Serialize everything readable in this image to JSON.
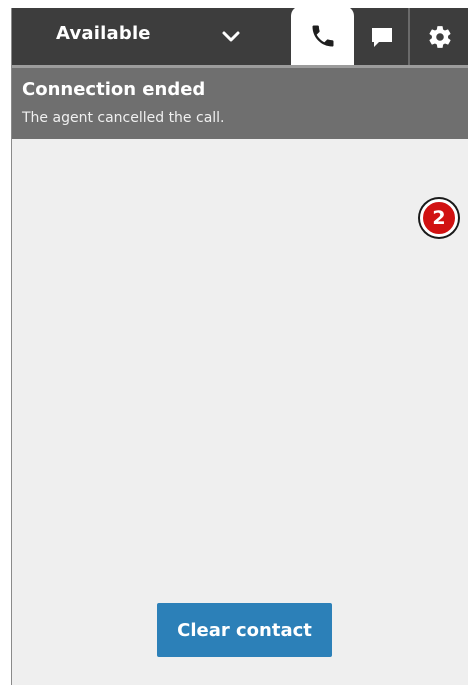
{
  "topbar": {
    "status": {
      "label": "Available",
      "icon": "chevron-down-icon"
    },
    "tabs": [
      {
        "icon": "phone-icon",
        "selected": true
      },
      {
        "icon": "chat-icon",
        "selected": false
      },
      {
        "icon": "gear-icon",
        "selected": false
      }
    ]
  },
  "banner": {
    "title": "Connection ended",
    "subtitle": "The agent cancelled the call."
  },
  "callout": {
    "number": "2",
    "color": "#d11212"
  },
  "actions": {
    "clear_label": "Clear contact",
    "color": "#2c80b8"
  }
}
